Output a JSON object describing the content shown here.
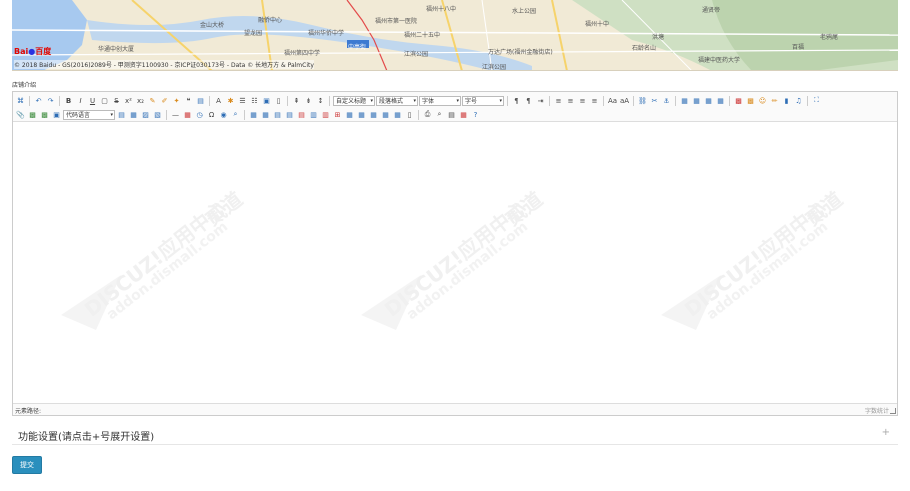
{
  "map": {
    "labels": [
      "融侨中心",
      "金山大桥",
      "望龙园",
      "华通中创大厦",
      "福州华侨中学",
      "福州第四中学",
      "中亭街",
      "福州市第一医院",
      "福州十八中",
      "福州二十五中",
      "水上公园",
      "江滨公园",
      "万达广场(福州金融街店)",
      "洪塘",
      "石龄名山",
      "通贤帝",
      "老鸦尾",
      "百福",
      "江滨公园",
      "福州十中",
      "福建中医药大学"
    ],
    "copyright_text": "© 2018 Baidu - GS(2016)2089号 - 甲测资字1100930 - 京ICP证030173号 - Data © 长地万方 & PalmCity",
    "logo_text": "Bai",
    "logo_text2": "百度"
  },
  "section_label": "店铺介绍",
  "toolbar": {
    "row1": {
      "select_custom_title": "自定义标题",
      "select_paragraph": "段落格式",
      "select_font": "字体",
      "select_size": "字号"
    },
    "row2": {
      "select_code_lang": "代码语言"
    }
  },
  "editor": {
    "watermark_main": "DISCUZ!应用中心",
    "watermark_sub": "addon.dismall.com",
    "watermark_brand": "贰道",
    "status_path_label": "元素路径:",
    "status_word_count": "字数统计"
  },
  "function_panel": {
    "title": "功能设置(请点击+号展开设置)",
    "toggle": "+"
  },
  "submit": {
    "label": "提交",
    "color": "#2a8fbd"
  }
}
